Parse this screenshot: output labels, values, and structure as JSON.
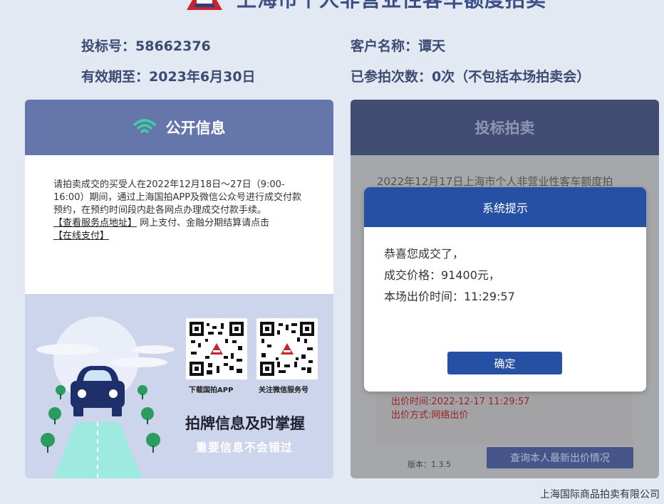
{
  "page": {
    "title": "上海市个人非营业性客车额度拍卖"
  },
  "header": {
    "bid_no_label": "投标号：",
    "bid_no": "58662376",
    "customer_label": "客户名称：",
    "customer": "谭天",
    "valid_label": "有效期至：",
    "valid_until": "2023年6月30日",
    "attempts_label": "已参拍次数：",
    "attempts": "0次（不包括本场拍卖会）"
  },
  "public_info": {
    "title": "公开信息",
    "body": "请拍卖成交的买受人在2022年12月18日～27日（9:00-16:00）期间，通过上海国拍APP及微信公众号进行成交付款预约，在预约时间段内赴各网点办理成交付款手续。",
    "link_service": "【查看服务点地址】",
    "pay_text": "网上支付、金融分期结算请点击",
    "link_pay": "【在线支付】",
    "qr_app_label": "下载国拍APP",
    "qr_wechat_label": "关注微信服务号",
    "slogan_main": "拍牌信息及时掌握",
    "slogan_sub": "重要信息不会错过"
  },
  "bidding": {
    "title": "投标拍卖",
    "notice": "2022年12月17日上海市个人非营业性客车额度拍",
    "bid_time": "出价时间:2022-12-17 11:29:57",
    "bid_method": "出价方式:网络出价",
    "version": "版本：1.3.5",
    "query_button": "查询本人最新出价情况"
  },
  "dialog": {
    "title": "系统提示",
    "line1": "恭喜您成交了，",
    "line2": "成交价格：91400元，",
    "line3": "本场出价时间：11:29:57",
    "ok_button": "确定"
  },
  "footer": {
    "company": "上海国际商品拍卖有限公司"
  },
  "colors": {
    "left_header": "#6576ab",
    "right_header": "#414d73",
    "dialog_blue": "#2650a3",
    "bid_red": "#9a2323"
  }
}
